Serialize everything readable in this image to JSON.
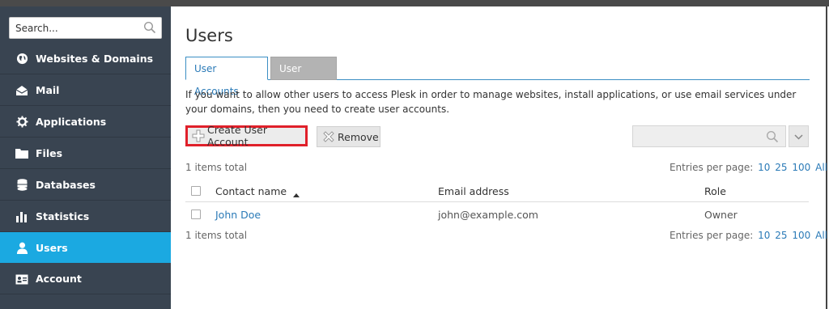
{
  "sidebar": {
    "search_placeholder": "Search...",
    "items": [
      {
        "label": "Websites & Domains",
        "icon": "globe-icon"
      },
      {
        "label": "Mail",
        "icon": "mail-icon"
      },
      {
        "label": "Applications",
        "icon": "gear-icon"
      },
      {
        "label": "Files",
        "icon": "folder-icon"
      },
      {
        "label": "Databases",
        "icon": "database-icon"
      },
      {
        "label": "Statistics",
        "icon": "bar-chart-icon"
      },
      {
        "label": "Users",
        "icon": "user-icon",
        "active": true
      },
      {
        "label": "Account",
        "icon": "account-card-icon"
      }
    ]
  },
  "main": {
    "title": "Users",
    "tabs": [
      {
        "label": "User Accounts",
        "active": true
      },
      {
        "label": "User Roles",
        "active": false
      }
    ],
    "intro": "If you want to allow other users to access Plesk in order to manage websites, install applications, or use email services under your domains, then you need to create user accounts.",
    "toolbar": {
      "create_label": "Create User Account",
      "remove_label": "Remove"
    },
    "items_total_top": "1 items total",
    "items_total_bottom": "1 items total",
    "per_page": {
      "label": "Entries per page:",
      "options": [
        "10",
        "25",
        "100",
        "All"
      ]
    },
    "table": {
      "columns": [
        "Contact name",
        "Email address",
        "Role"
      ],
      "rows": [
        {
          "name": "John Doe",
          "email": "john@example.com",
          "role": "Owner"
        }
      ]
    }
  },
  "colors": {
    "sidebar_bg": "#394451",
    "active_nav": "#1ba9e1",
    "link": "#2a7ab7",
    "highlight_border": "#e0202a"
  }
}
